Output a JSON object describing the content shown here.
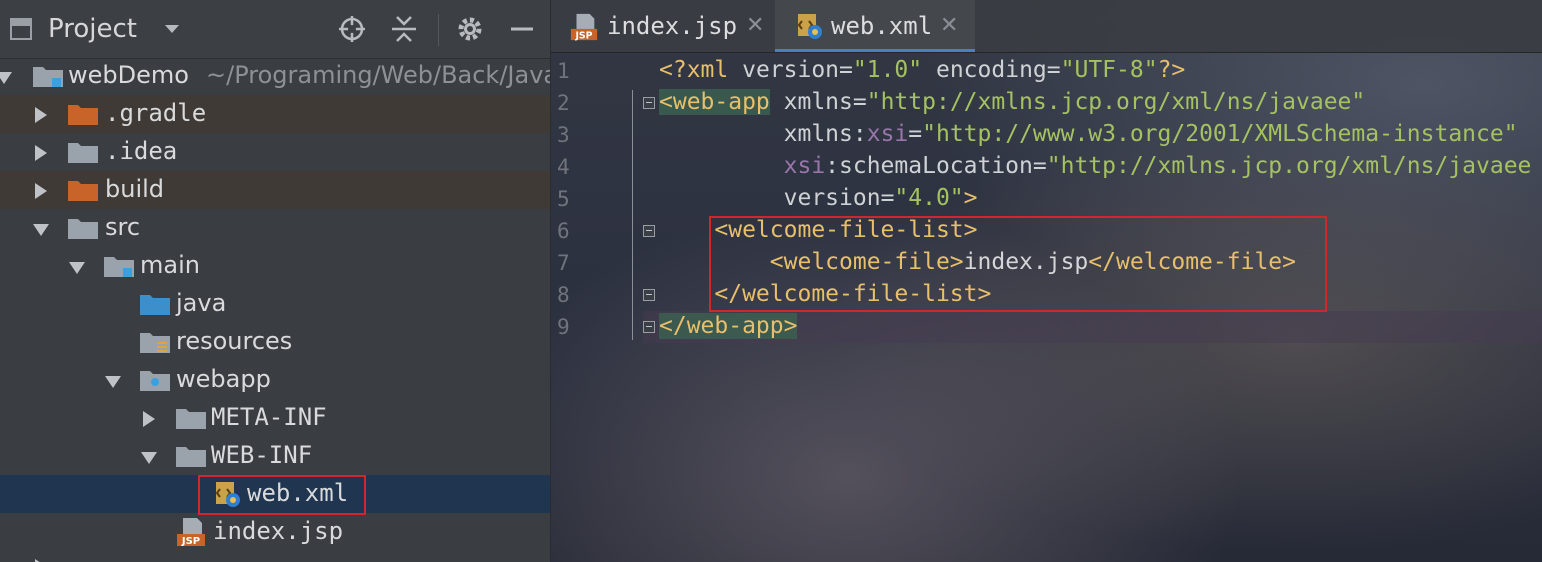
{
  "project_panel": {
    "title": "Project",
    "tree": [
      {
        "label": "webDemo",
        "path": "~/Programing/Web/Back/Java",
        "icon": "module-folder-icon",
        "state": "expanded"
      },
      {
        "label": ".gradle",
        "icon": "folder-orange-icon",
        "state": "collapsed"
      },
      {
        "label": ".idea",
        "icon": "folder-icon",
        "state": "collapsed"
      },
      {
        "label": "build",
        "icon": "folder-orange-icon",
        "state": "collapsed"
      },
      {
        "label": "src",
        "icon": "folder-icon",
        "state": "expanded"
      },
      {
        "label": "main",
        "icon": "module-folder-icon",
        "state": "expanded"
      },
      {
        "label": "java",
        "icon": "source-folder-blue-icon",
        "state": "leaf"
      },
      {
        "label": "resources",
        "icon": "resources-folder-icon",
        "state": "leaf"
      },
      {
        "label": "webapp",
        "icon": "web-folder-icon",
        "state": "expanded"
      },
      {
        "label": "META-INF",
        "icon": "folder-icon",
        "state": "collapsed"
      },
      {
        "label": "WEB-INF",
        "icon": "folder-icon",
        "state": "expanded"
      },
      {
        "label": "web.xml",
        "icon": "xml-web-file-icon",
        "state": "selected"
      },
      {
        "label": "index.jsp",
        "icon": "jsp-file-icon",
        "state": "leaf"
      }
    ]
  },
  "editor": {
    "tabs": [
      {
        "label": "index.jsp",
        "icon": "jsp-file-icon",
        "active": false
      },
      {
        "label": "web.xml",
        "icon": "xml-web-file-icon",
        "active": true
      }
    ],
    "line_numbers": [
      "1",
      "2",
      "3",
      "4",
      "5",
      "6",
      "7",
      "8",
      "9"
    ],
    "code": {
      "l1": {
        "open": "<?xml",
        "attr1": " version",
        "eq1": "=",
        "val1": "\"1.0\"",
        "attr2": " encoding",
        "eq2": "=",
        "val2": "\"UTF-8\"",
        "close": "?>"
      },
      "l2": {
        "tag": "<web-app",
        "attr": " xmlns",
        "eq": "=",
        "val": "\"http://xmlns.jcp.org/xml/ns/javaee\""
      },
      "l3": {
        "indent": "         ",
        "attr": "xmlns:",
        "ns": "xsi",
        "eq": "=",
        "val": "\"http://www.w3.org/2001/XMLSchema-instance\""
      },
      "l4": {
        "indent": "         ",
        "ns": "xsi",
        "attr": ":schemaLocation",
        "eq": "=",
        "val": "\"http://xmlns.jcp.org/xml/ns/javaee"
      },
      "l5": {
        "indent": "         ",
        "attr": "version",
        "eq": "=",
        "val": "\"4.0\"",
        "close": ">"
      },
      "l6": {
        "indent": "    ",
        "tag": "<welcome-file-list>"
      },
      "l7": {
        "indent": "        ",
        "open": "<welcome-file>",
        "text": "index.jsp",
        "close": "</welcome-file>"
      },
      "l8": {
        "indent": "    ",
        "tag": "</welcome-file-list>"
      },
      "l9": {
        "tag": "</web-app>"
      }
    }
  },
  "colors": {
    "tag": "#e8bf6a",
    "attribute": "#cfd2d5",
    "namespace": "#9876aa",
    "string": "#a5c261",
    "highlight_box": "#d0262e",
    "selection": "#1f3550"
  }
}
